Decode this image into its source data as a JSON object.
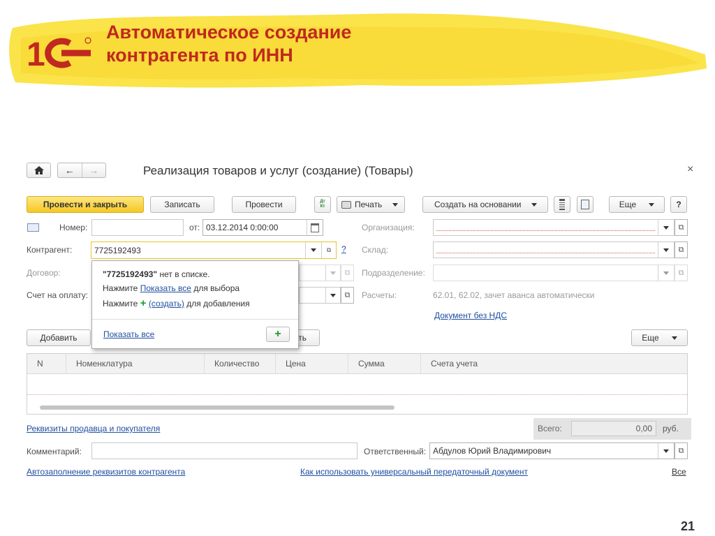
{
  "slide": {
    "title_line1": "Автоматическое создание",
    "title_line2": "контрагента по ИНН",
    "logo_text": "1С",
    "page_number": "21"
  },
  "window": {
    "title": "Реализация товаров и услуг (создание) (Товары)",
    "close_icon": "×"
  },
  "toolbar": {
    "post_close": "Провести и закрыть",
    "save": "Записать",
    "post": "Провести",
    "dtkt_icon": "Дт Кт",
    "print": "Печать",
    "create_based": "Создать на основании",
    "more": "Еще",
    "help": "?"
  },
  "form": {
    "number_label": "Номер:",
    "number_value": "",
    "date_label": "от:",
    "date_value": "03.12.2014  0:00:00",
    "org_label": "Организация:",
    "counterparty_label": "Контрагент:",
    "counterparty_value": "7725192493",
    "counterparty_help": "?",
    "warehouse_label": "Склад:",
    "contract_label": "Договор:",
    "division_label": "Подразделение:",
    "invoice_label": "Счет на оплату:",
    "settlements_label": "Расчеты:",
    "settlements_value": "62.01, 62.02, зачет аванса автоматически",
    "no_vat_link": "Документ без НДС"
  },
  "popup": {
    "not_found_code": "\"7725192493\"",
    "not_found_rest": "нет в списке.",
    "line2_prefix": "Нажмите",
    "line2_link": "Показать все",
    "line2_suffix": "для выбора",
    "line3_prefix": "Нажмите",
    "line3_plus": "+",
    "line3_link": "(создать)",
    "line3_suffix": "для добавления",
    "show_all_link": "Показать все",
    "add_button": "+"
  },
  "table_toolbar": {
    "add": "Добавить",
    "hidden_btn_tail": "ть",
    "more": "Еще"
  },
  "table": {
    "columns": [
      "N",
      "Номенклатура",
      "Количество",
      "Цена",
      "Сумма",
      "Счета учета"
    ]
  },
  "footer": {
    "requisites_link": "Реквизиты продавца и покупателя",
    "total_label": "Всего:",
    "total_value": "0,00",
    "currency": "руб.",
    "comment_label": "Комментарий:",
    "comment_value": "",
    "responsible_label": "Ответственный:",
    "responsible_value": "Абдулов Юрий Владимирович",
    "autofill_link": "Автозаполнение реквизитов контрагента",
    "upd_link": "Как использовать универсальный передаточный документ",
    "all_link": "Все"
  },
  "colors": {
    "title_red": "#c0291f",
    "banner_yellow": "#fbe34a",
    "primary_button": "#f6c823",
    "link_blue": "#1e4fa0",
    "plus_green": "#1f9a2e"
  }
}
